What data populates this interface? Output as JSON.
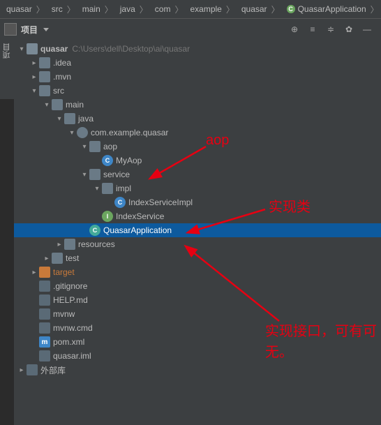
{
  "breadcrumb": {
    "items": [
      "quasar",
      "src",
      "main",
      "java",
      "com",
      "example",
      "quasar"
    ],
    "file": "QuasarApplication"
  },
  "toolbar": {
    "project_label": "项目",
    "side_tab_label": "项目"
  },
  "tree": {
    "root": {
      "name": "quasar",
      "path": "C:\\Users\\dell\\Desktop\\ai\\quasar"
    },
    "idea": ".idea",
    "mvn": ".mvn",
    "src": "src",
    "main": "main",
    "java": "java",
    "package": "com.example.quasar",
    "aop": "aop",
    "myaop": "MyAop",
    "service": "service",
    "impl": "impl",
    "indexserviceimpl": "IndexServiceImpl",
    "indexservice": "IndexService",
    "quasarapp": "QuasarApplication",
    "resources": "resources",
    "test": "test",
    "target": "target",
    "gitignore": ".gitignore",
    "helpmd": "HELP.md",
    "mvnw": "mvnw",
    "mvnwcmd": "mvnw.cmd",
    "pomxml": "pom.xml",
    "quasariml": "quasar.iml",
    "external": "外部库"
  },
  "annotations": {
    "aop": "aop",
    "impl": "实现类",
    "interface": "实现接口，可有可无。"
  }
}
